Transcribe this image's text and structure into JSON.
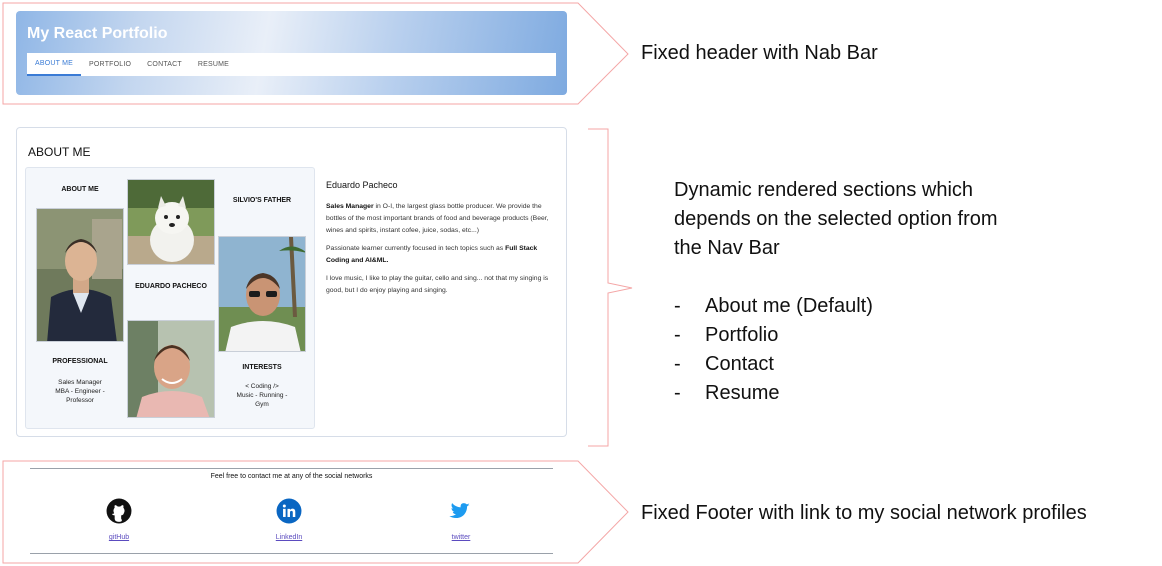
{
  "header": {
    "title": "My React Portfolio",
    "nav": [
      "ABOUT ME",
      "PORTFOLIO",
      "CONTACT",
      "RESUME"
    ],
    "active_index": 0
  },
  "about": {
    "section_title": "ABOUT ME",
    "collage": {
      "about_label": "ABOUT ME",
      "father_label": "SILVIO'S FATHER",
      "name_label": "EDUARDO PACHECO",
      "professional_label": "PROFESSIONAL",
      "professional_text": [
        "Sales Manager",
        "MBA   -   Engineer   -",
        "Professor"
      ],
      "interests_label": "INTERESTS",
      "interests_text": [
        "< Coding />",
        "Music   -   Running   -",
        "Gym"
      ]
    },
    "bio": {
      "name": "Eduardo Pacheco",
      "p1_bold": "Sales Manager",
      "p1_rest": " in O-I, the largest glass bottle producer. We provide the bottles of the most important brands of food and beverage products (Beer, wines and spirits, instant cofee, juice, sodas, etc...)",
      "p2_start": "Passionate learner currently focused in tech topics such as ",
      "p2_bold": "Full Stack Coding and AI&ML.",
      "p3": "I love music, I like to play the guitar, cello and sing... not that my singing is good, but I do enjoy playing and singing."
    }
  },
  "footer": {
    "tagline": "Feel free to contact me at any of the social networks",
    "links": [
      {
        "label": "gitHub",
        "icon": "github-icon"
      },
      {
        "label": "LinkedIn",
        "icon": "linkedin-icon"
      },
      {
        "label": "twitter",
        "icon": "twitter-icon"
      }
    ]
  },
  "annotations": {
    "header_note": "Fixed header with Nab Bar",
    "section_note_lines": [
      "Dynamic rendered sections which",
      "depends on the selected option from",
      "the Nav Bar"
    ],
    "section_options": [
      "About me (Default)",
      "Portfolio",
      "Contact",
      "Resume"
    ],
    "footer_note": "Fixed Footer with link to my social network profiles"
  },
  "colors": {
    "accent": "#3a7bd5",
    "callout": "#f4a6a6",
    "link": "#5b4bbf",
    "linkedin": "#0a66c2",
    "twitter": "#1d9bf0"
  }
}
